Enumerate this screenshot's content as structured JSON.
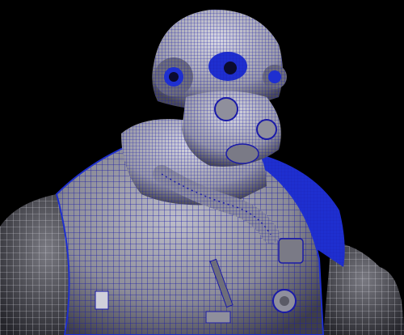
{
  "viewport": {
    "background": "#000000",
    "wire_color": "#1a1aa8",
    "shade_color": "#8a8a96",
    "highlight_color": "#c9c9d6",
    "selection_color": "#1e2fd0"
  },
  "scene": {
    "parts": [
      {
        "name": "helmet-dome",
        "icon": "helmet"
      },
      {
        "name": "goggle-left",
        "icon": "lens"
      },
      {
        "name": "goggle-right",
        "icon": "lens"
      },
      {
        "name": "face-mask",
        "icon": "respirator"
      },
      {
        "name": "breathing-hose",
        "icon": "hose"
      },
      {
        "name": "collar",
        "icon": "collar"
      },
      {
        "name": "vest-torso",
        "icon": "vest"
      },
      {
        "name": "left-arm",
        "icon": "arm"
      },
      {
        "name": "right-arm",
        "icon": "arm"
      },
      {
        "name": "shoulder-pad",
        "icon": "pad"
      },
      {
        "name": "chest-straps",
        "icon": "strap"
      }
    ]
  },
  "watermark": {
    "text": ""
  }
}
